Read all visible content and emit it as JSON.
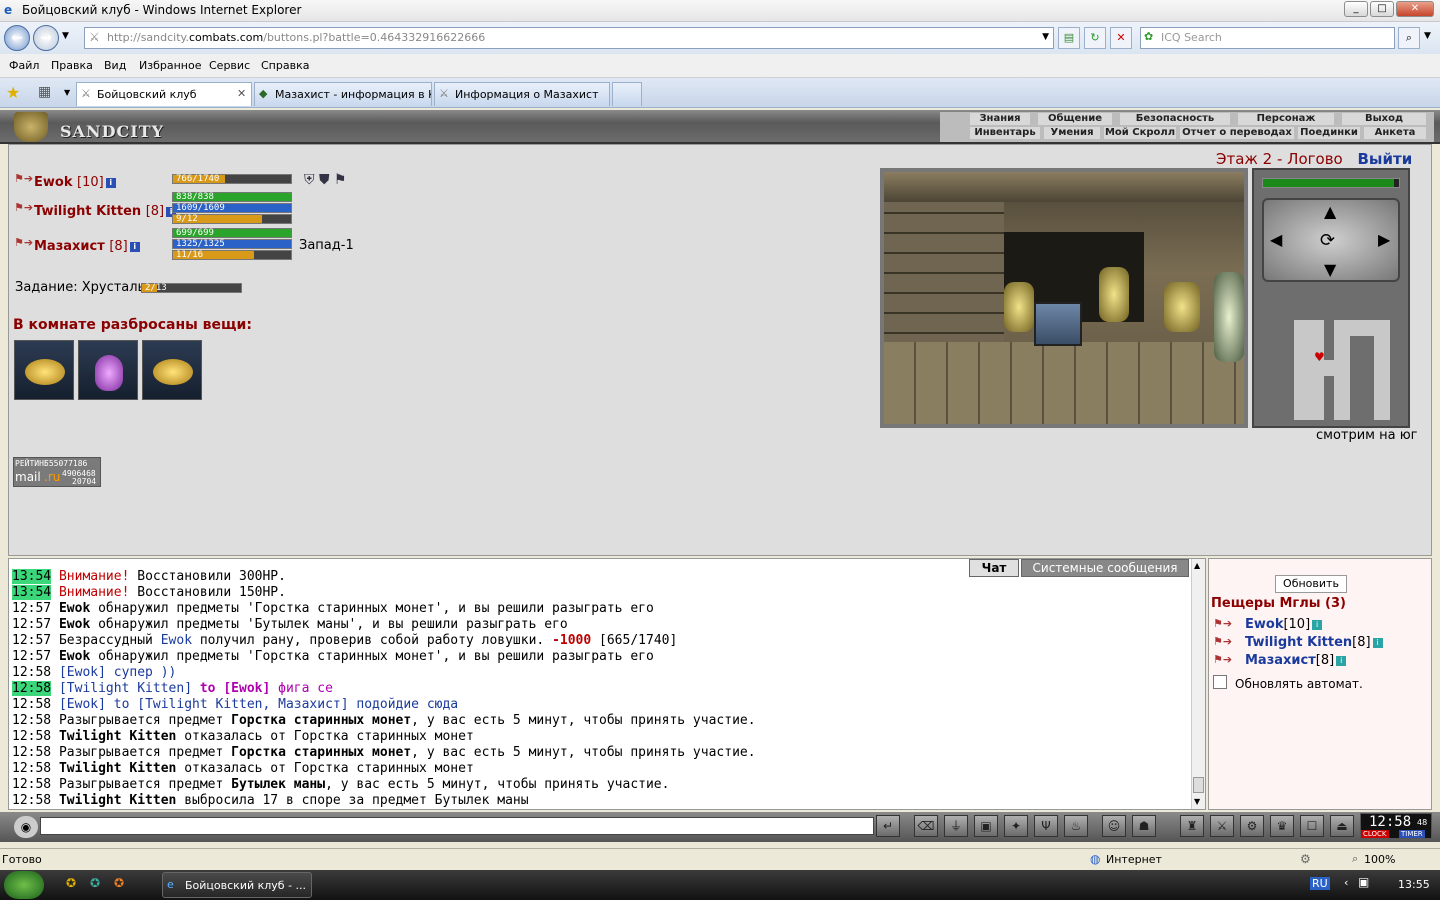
{
  "window": {
    "title": "Бойцовский клуб - Windows Internet Explorer"
  },
  "address": {
    "url_prefix": "http://sandcity.",
    "url_domain": "combats.com",
    "url_rest": "/buttons.pl?battle=0.464332916622666",
    "search_placeholder": "ICQ Search"
  },
  "menu": [
    "Файл",
    "Правка",
    "Вид",
    "Избранное",
    "Сервис",
    "Справка"
  ],
  "tabs": [
    {
      "label": "Бойцовский клуб",
      "active": true
    },
    {
      "label": "Мазахист - информация в К...",
      "active": false
    },
    {
      "label": "Информация о Мазахист",
      "active": false
    }
  ],
  "game": {
    "logo": "SANDCITY",
    "nav_top": [
      "Знания",
      "Общение",
      "Безопасность",
      "Персонаж",
      "Выход"
    ],
    "nav_bottom": [
      "Инвентарь",
      "Умения",
      "Мой Скролл",
      "Отчет о переводах",
      "Поединки",
      "Анкета"
    ],
    "location": "Этаж 2 - Логово",
    "exit_label": "Выйти",
    "direction": "Запад-1",
    "facing": "смотрим на юг",
    "task_label": "Задание: Хрусталь",
    "task_progress": "2/13",
    "task_fraction": 0.154,
    "items_heading": "В комнате разбросаны вещи:",
    "items": [
      "coins-icon",
      "mana-potion-icon",
      "coins-icon"
    ],
    "rating": {
      "label": "РЕЙТИНГ",
      "n1": "555077186",
      "n2": "4906468",
      "n3": "20704",
      "brand_a": "mail",
      "brand_b": ".ru"
    },
    "players": [
      {
        "name": "Ewok",
        "level": "[10]",
        "bars": [
          {
            "text": "766/1740",
            "frac": 0.44,
            "color": "#d99a1a"
          }
        ]
      },
      {
        "name": "Twilight Kitten",
        "level": "[8]",
        "bars": [
          {
            "text": "838/838",
            "frac": 1.0,
            "color": "#2aa42a"
          },
          {
            "text": "1609/1609",
            "frac": 1.0,
            "color": "#2a62c8"
          },
          {
            "text": "9/12",
            "frac": 0.75,
            "color": "#d99a1a"
          }
        ]
      },
      {
        "name": "Мазахист",
        "level": "[8]",
        "bars": [
          {
            "text": "699/699",
            "frac": 1.0,
            "color": "#2aa42a"
          },
          {
            "text": "1325/1325",
            "frac": 1.0,
            "color": "#2a62c8"
          },
          {
            "text": "11/16",
            "frac": 0.69,
            "color": "#d99a1a"
          }
        ]
      }
    ]
  },
  "chat": {
    "tabs": [
      "Чат",
      "Системные сообщения"
    ],
    "lines": [
      {
        "time": "13:54",
        "hl": true,
        "parts": [
          {
            "t": "Внимание!",
            "c": "#c00000"
          },
          {
            "t": " Восстановили 300HP."
          }
        ]
      },
      {
        "time": "13:54",
        "hl": true,
        "parts": [
          {
            "t": "Внимание!",
            "c": "#c00000"
          },
          {
            "t": " Восстановили 150HP."
          }
        ]
      },
      {
        "time": "12:57",
        "parts": [
          {
            "t": "Ewok",
            "b": true
          },
          {
            "t": " обнаружил предметы 'Горстка старинных монет', и вы решили разыграть его"
          }
        ]
      },
      {
        "time": "12:57",
        "parts": [
          {
            "t": "Ewok",
            "b": true
          },
          {
            "t": " обнаружил предметы 'Бутылек маны', и вы решили разыграть его"
          }
        ]
      },
      {
        "time": "12:57",
        "parts": [
          {
            "t": "Безрассудный "
          },
          {
            "t": "Ewok",
            "c": "#1a3a9c"
          },
          {
            "t": " получил рану, проверив собой работу ловушки. "
          },
          {
            "t": "-1000",
            "c": "#c00000",
            "b": true
          },
          {
            "t": " [665/1740]"
          }
        ]
      },
      {
        "time": "12:57",
        "parts": [
          {
            "t": "Ewok",
            "b": true
          },
          {
            "t": " обнаружил предметы 'Горстка старинных монет', и вы решили разыграть его"
          }
        ]
      },
      {
        "time": "12:58",
        "parts": [
          {
            "t": "[Ewok] супер ))",
            "c": "#1a3a9c"
          }
        ]
      },
      {
        "time": "12:58",
        "hl": true,
        "parts": [
          {
            "t": "[Twilight Kitten]",
            "c": "#1a3a9c"
          },
          {
            "t": " to [Ewok]",
            "c": "#b000b0",
            "b": true
          },
          {
            "t": " фига се",
            "c": "#b000b0"
          }
        ]
      },
      {
        "time": "12:58",
        "parts": [
          {
            "t": "[Ewok]",
            "c": "#1a3a9c"
          },
          {
            "t": " to [Twilight Kitten, Мазахист] подойдие сюда",
            "c": "#1a3a9c"
          }
        ]
      },
      {
        "time": "12:58",
        "parts": [
          {
            "t": "Разыгрывается предмет "
          },
          {
            "t": "Горстка старинных монет",
            "b": true
          },
          {
            "t": ", у вас есть 5 минут, чтобы принять участие."
          }
        ]
      },
      {
        "time": "12:58",
        "parts": [
          {
            "t": "Twilight Kitten",
            "b": true
          },
          {
            "t": " отказалась от Горстка старинных монет"
          }
        ]
      },
      {
        "time": "12:58",
        "parts": [
          {
            "t": "Разыгрывается предмет "
          },
          {
            "t": "Горстка старинных монет",
            "b": true
          },
          {
            "t": ", у вас есть 5 минут, чтобы принять участие."
          }
        ]
      },
      {
        "time": "12:58",
        "parts": [
          {
            "t": "Twilight Kitten",
            "b": true
          },
          {
            "t": " отказалась от Горстка старинных монет"
          }
        ]
      },
      {
        "time": "12:58",
        "parts": [
          {
            "t": "Разыгрывается предмет "
          },
          {
            "t": "Бутылек маны",
            "b": true
          },
          {
            "t": ", у вас есть 5 минут, чтобы принять участие."
          }
        ]
      },
      {
        "time": "12:58",
        "parts": [
          {
            "t": "Twilight Kitten",
            "b": true
          },
          {
            "t": " выбросила 17 в споре за предмет Бутылек маны"
          }
        ]
      }
    ]
  },
  "online": {
    "refresh_label": "Обновить",
    "room_title": "Пещеры Мглы (3)",
    "users": [
      {
        "name": "Ewok",
        "level": "[10]"
      },
      {
        "name": "Twilight Kitten",
        "level": "[8]"
      },
      {
        "name": "Мазахист",
        "level": "[8]"
      }
    ],
    "auto_refresh_label": "Обновлять автомат."
  },
  "clock": {
    "time": "12:58",
    "sec": "48",
    "clock_label": "CLOCK",
    "timer_label": "TIMER"
  },
  "status": {
    "text": "Готово",
    "zone": "Интернет",
    "zoom": "100%"
  },
  "taskbar": {
    "task": "Бойцовский клуб - ...",
    "lang": "RU",
    "time": "13:55"
  },
  "colors": {
    "accent": "#8b0000",
    "link": "#1a3a9c",
    "highlight": "#3ad87a"
  }
}
